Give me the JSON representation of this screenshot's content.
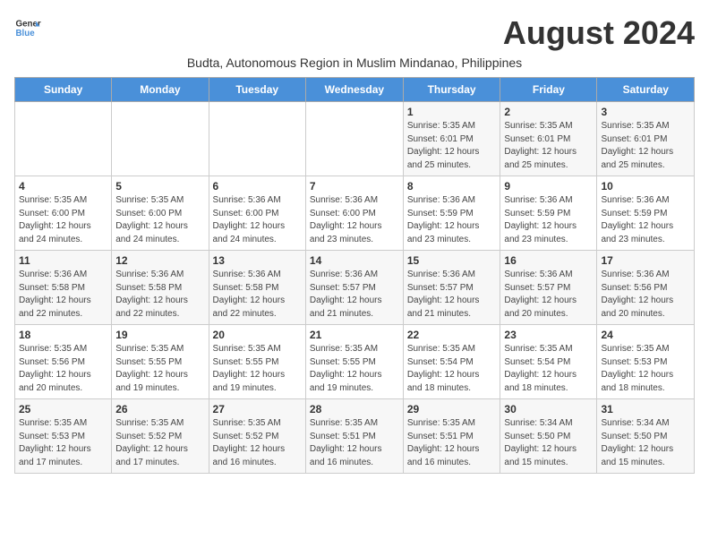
{
  "logo": {
    "line1": "General",
    "line2": "Blue"
  },
  "title": "August 2024",
  "subtitle": "Budta, Autonomous Region in Muslim Mindanao, Philippines",
  "days_header": [
    "Sunday",
    "Monday",
    "Tuesday",
    "Wednesday",
    "Thursday",
    "Friday",
    "Saturday"
  ],
  "weeks": [
    [
      {
        "day": "",
        "info": ""
      },
      {
        "day": "",
        "info": ""
      },
      {
        "day": "",
        "info": ""
      },
      {
        "day": "",
        "info": ""
      },
      {
        "day": "1",
        "info": "Sunrise: 5:35 AM\nSunset: 6:01 PM\nDaylight: 12 hours\nand 25 minutes."
      },
      {
        "day": "2",
        "info": "Sunrise: 5:35 AM\nSunset: 6:01 PM\nDaylight: 12 hours\nand 25 minutes."
      },
      {
        "day": "3",
        "info": "Sunrise: 5:35 AM\nSunset: 6:01 PM\nDaylight: 12 hours\nand 25 minutes."
      }
    ],
    [
      {
        "day": "4",
        "info": "Sunrise: 5:35 AM\nSunset: 6:00 PM\nDaylight: 12 hours\nand 24 minutes."
      },
      {
        "day": "5",
        "info": "Sunrise: 5:35 AM\nSunset: 6:00 PM\nDaylight: 12 hours\nand 24 minutes."
      },
      {
        "day": "6",
        "info": "Sunrise: 5:36 AM\nSunset: 6:00 PM\nDaylight: 12 hours\nand 24 minutes."
      },
      {
        "day": "7",
        "info": "Sunrise: 5:36 AM\nSunset: 6:00 PM\nDaylight: 12 hours\nand 23 minutes."
      },
      {
        "day": "8",
        "info": "Sunrise: 5:36 AM\nSunset: 5:59 PM\nDaylight: 12 hours\nand 23 minutes."
      },
      {
        "day": "9",
        "info": "Sunrise: 5:36 AM\nSunset: 5:59 PM\nDaylight: 12 hours\nand 23 minutes."
      },
      {
        "day": "10",
        "info": "Sunrise: 5:36 AM\nSunset: 5:59 PM\nDaylight: 12 hours\nand 23 minutes."
      }
    ],
    [
      {
        "day": "11",
        "info": "Sunrise: 5:36 AM\nSunset: 5:58 PM\nDaylight: 12 hours\nand 22 minutes."
      },
      {
        "day": "12",
        "info": "Sunrise: 5:36 AM\nSunset: 5:58 PM\nDaylight: 12 hours\nand 22 minutes."
      },
      {
        "day": "13",
        "info": "Sunrise: 5:36 AM\nSunset: 5:58 PM\nDaylight: 12 hours\nand 22 minutes."
      },
      {
        "day": "14",
        "info": "Sunrise: 5:36 AM\nSunset: 5:57 PM\nDaylight: 12 hours\nand 21 minutes."
      },
      {
        "day": "15",
        "info": "Sunrise: 5:36 AM\nSunset: 5:57 PM\nDaylight: 12 hours\nand 21 minutes."
      },
      {
        "day": "16",
        "info": "Sunrise: 5:36 AM\nSunset: 5:57 PM\nDaylight: 12 hours\nand 20 minutes."
      },
      {
        "day": "17",
        "info": "Sunrise: 5:36 AM\nSunset: 5:56 PM\nDaylight: 12 hours\nand 20 minutes."
      }
    ],
    [
      {
        "day": "18",
        "info": "Sunrise: 5:35 AM\nSunset: 5:56 PM\nDaylight: 12 hours\nand 20 minutes."
      },
      {
        "day": "19",
        "info": "Sunrise: 5:35 AM\nSunset: 5:55 PM\nDaylight: 12 hours\nand 19 minutes."
      },
      {
        "day": "20",
        "info": "Sunrise: 5:35 AM\nSunset: 5:55 PM\nDaylight: 12 hours\nand 19 minutes."
      },
      {
        "day": "21",
        "info": "Sunrise: 5:35 AM\nSunset: 5:55 PM\nDaylight: 12 hours\nand 19 minutes."
      },
      {
        "day": "22",
        "info": "Sunrise: 5:35 AM\nSunset: 5:54 PM\nDaylight: 12 hours\nand 18 minutes."
      },
      {
        "day": "23",
        "info": "Sunrise: 5:35 AM\nSunset: 5:54 PM\nDaylight: 12 hours\nand 18 minutes."
      },
      {
        "day": "24",
        "info": "Sunrise: 5:35 AM\nSunset: 5:53 PM\nDaylight: 12 hours\nand 18 minutes."
      }
    ],
    [
      {
        "day": "25",
        "info": "Sunrise: 5:35 AM\nSunset: 5:53 PM\nDaylight: 12 hours\nand 17 minutes."
      },
      {
        "day": "26",
        "info": "Sunrise: 5:35 AM\nSunset: 5:52 PM\nDaylight: 12 hours\nand 17 minutes."
      },
      {
        "day": "27",
        "info": "Sunrise: 5:35 AM\nSunset: 5:52 PM\nDaylight: 12 hours\nand 16 minutes."
      },
      {
        "day": "28",
        "info": "Sunrise: 5:35 AM\nSunset: 5:51 PM\nDaylight: 12 hours\nand 16 minutes."
      },
      {
        "day": "29",
        "info": "Sunrise: 5:35 AM\nSunset: 5:51 PM\nDaylight: 12 hours\nand 16 minutes."
      },
      {
        "day": "30",
        "info": "Sunrise: 5:34 AM\nSunset: 5:50 PM\nDaylight: 12 hours\nand 15 minutes."
      },
      {
        "day": "31",
        "info": "Sunrise: 5:34 AM\nSunset: 5:50 PM\nDaylight: 12 hours\nand 15 minutes."
      }
    ]
  ]
}
